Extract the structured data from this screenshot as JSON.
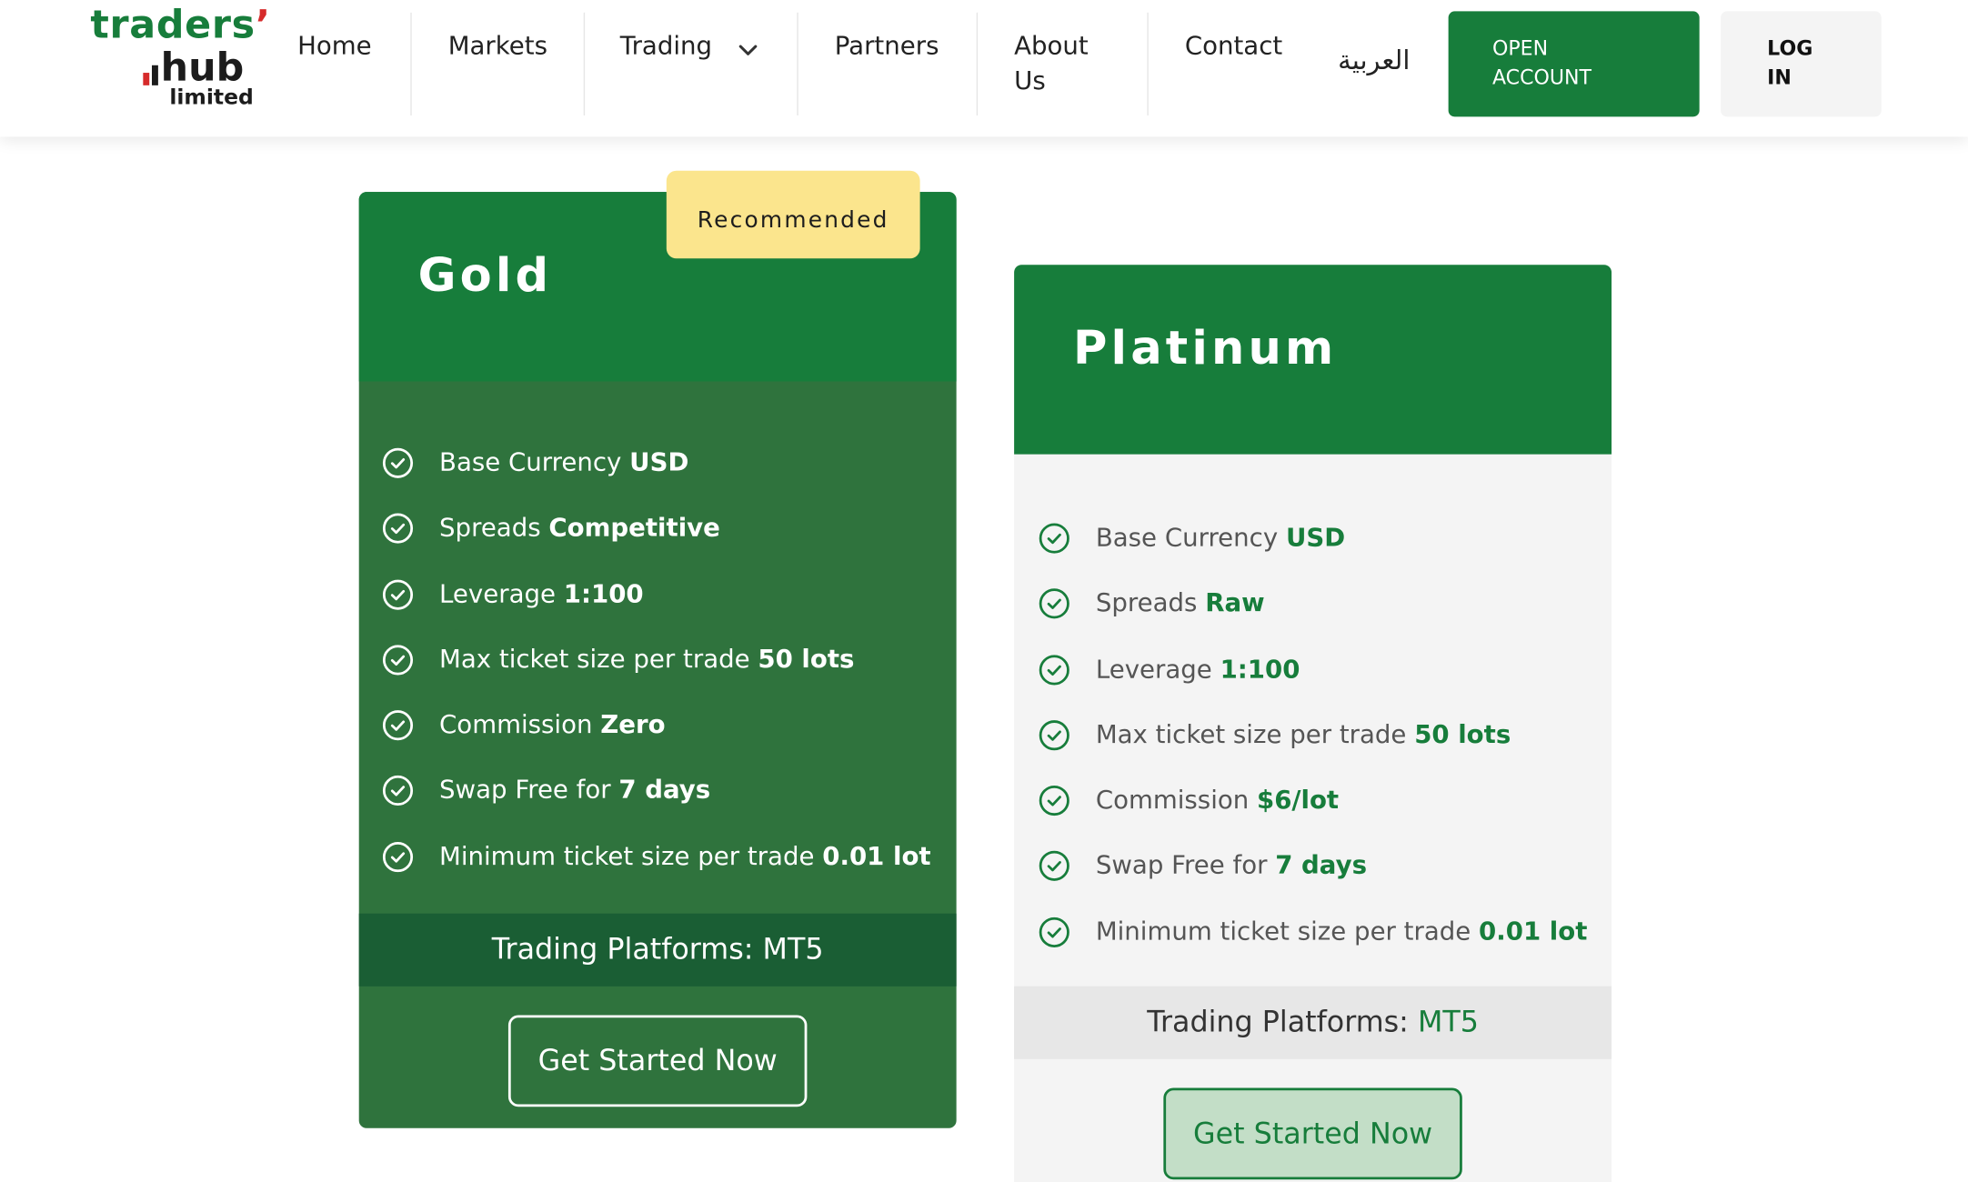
{
  "brand": {
    "line1": "traders",
    "apostrophe": "’",
    "line2": "hub",
    "line3": "limited",
    "colors": {
      "green": "#177d3b",
      "red": "#d62b2b",
      "dark": "#1c1c1c"
    }
  },
  "nav": {
    "home": "Home",
    "markets": "Markets",
    "trading": "Trading",
    "partners": "Partners",
    "about_line1": "About",
    "about_line2": "Us",
    "contact": "Contact",
    "language": "العربية",
    "open_line1": "OPEN",
    "open_line2": "ACCOUNT",
    "login_line1": "LOG",
    "login_line2": "IN",
    "trading_icon": "chevron-down-icon"
  },
  "plans": {
    "gold": {
      "title": "Gold",
      "badge": "Recommended",
      "features": [
        {
          "label": "Base Currency",
          "value": "USD"
        },
        {
          "label": "Spreads",
          "value": "Competitive"
        },
        {
          "label": "Leverage",
          "value": "1:100"
        },
        {
          "label": "Max ticket size per trade",
          "value": "50 lots"
        },
        {
          "label": "Commission",
          "value": "Zero"
        },
        {
          "label": "Swap Free for",
          "value": "7 days"
        },
        {
          "label": "Minimum ticket size per trade",
          "value": "0.01 lot"
        }
      ],
      "platforms_label": "Trading Platforms:",
      "platforms_value": "MT5",
      "cta": "Get Started Now"
    },
    "platinum": {
      "title": "Platinum",
      "features": [
        {
          "label": "Base Currency",
          "value": "USD"
        },
        {
          "label": "Spreads",
          "value": "Raw"
        },
        {
          "label": "Leverage",
          "value": "1:100"
        },
        {
          "label": "Max ticket size per trade",
          "value": "50 lots"
        },
        {
          "label": "Commission",
          "value": "$6/lot"
        },
        {
          "label": "Swap Free for",
          "value": "7 days"
        },
        {
          "label": "Minimum ticket size per trade",
          "value": "0.01 lot"
        }
      ],
      "platforms_label": "Trading Platforms:",
      "platforms_value": "MT5",
      "cta": "Get Started Now"
    }
  },
  "colors": {
    "primary_green": "#177d3b",
    "gold_card_body": "#2f733d",
    "gold_platform_band": "#1a5e34",
    "badge_yellow": "#fbe58d",
    "platinum_body": "#f4f4f4",
    "check_icon": "check-circle-icon"
  }
}
